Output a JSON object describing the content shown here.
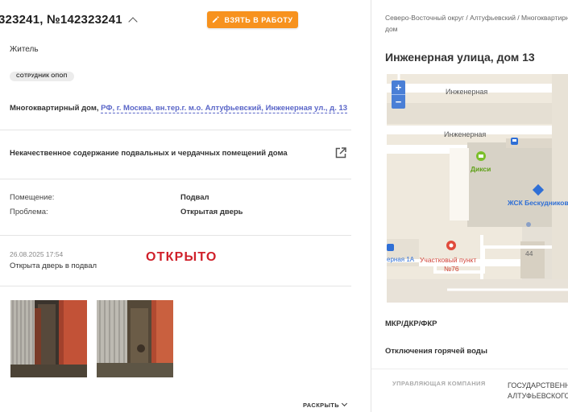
{
  "ticket": {
    "title": "323241, №142323241",
    "take_button_label": "ВЗЯТЬ В РАБОТУ",
    "applicant_type": "Житель",
    "badge": "СОТРУДНИК ОПОП",
    "address_prefix": "Многоквартирный дом,",
    "address_link": "РФ, г. Москва, вн.тер.г. м.о. Алтуфьевский, Инженерная ул., д. 13",
    "issue_title": "Некачественное содержание подвальных и чердачных помещений дома",
    "fields": [
      {
        "label": "Помещение:",
        "value": "Подвал"
      },
      {
        "label": "Проблема:",
        "value": "Открытая дверь"
      }
    ],
    "event": {
      "date": "26.08.2025 17:54",
      "comment": "Открыта дверь в подвал",
      "status": "ОТКРЫТО"
    },
    "expand_label": "РАСКРЫТЬ",
    "accent_color": "#f7921e",
    "status_color": "#d0202a"
  },
  "sidepanel": {
    "breadcrumb": "Северо-Восточный округ / Алтуфьевский / Многоквартирный дом",
    "address_title": "Инженерная улица, дом 13",
    "map": {
      "zoom_in": "+",
      "zoom_out": "−",
      "labels": {
        "street_1": "Инженерная",
        "street_2": "Инженерная",
        "shop": "Дикси",
        "zhsk": "ЖСК Бескудниково",
        "police": "Участковый пункт",
        "police_num": "№76",
        "building_num": "44",
        "bus_stop": "ерная 1А"
      }
    },
    "mkr_label": "МКР/ДКР/ФКР",
    "hot_water_label": "Отключения горячей воды",
    "management_label": "УПРАВЛЯЮЩАЯ КОМПАНИЯ",
    "management_value_1": "ГОСУДАРСТВЕННОЕ",
    "management_value_2": "АЛТУФЬЕВСКОГО"
  }
}
